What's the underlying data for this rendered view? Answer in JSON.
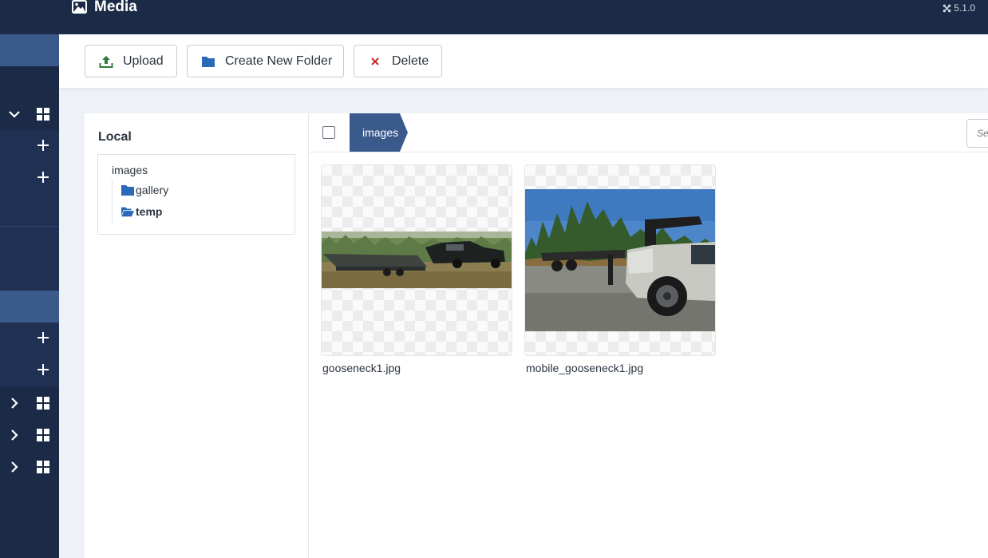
{
  "header": {
    "title": "Media",
    "version": "5.1.0"
  },
  "toolbar": {
    "upload_label": "Upload",
    "create_folder_label": "Create New Folder",
    "delete_label": "Delete"
  },
  "tree": {
    "heading": "Local",
    "root": "images",
    "folders": [
      {
        "label": "gallery",
        "icon": "folder-icon",
        "active": false
      },
      {
        "label": "temp",
        "icon": "folder-open-icon",
        "active": true
      }
    ]
  },
  "browser": {
    "breadcrumb": "images",
    "search_placeholder": "Search",
    "items": [
      {
        "name": "gooseneck1.jpg"
      },
      {
        "name": "mobile_gooseneck1.jpg"
      }
    ]
  },
  "colors": {
    "sidebar_bg": "#1b2a47",
    "accent": "#3a5a8c",
    "folder_icon": "#2a69b8",
    "upload_icon": "#2f7d3b",
    "delete_icon": "#c52826"
  }
}
